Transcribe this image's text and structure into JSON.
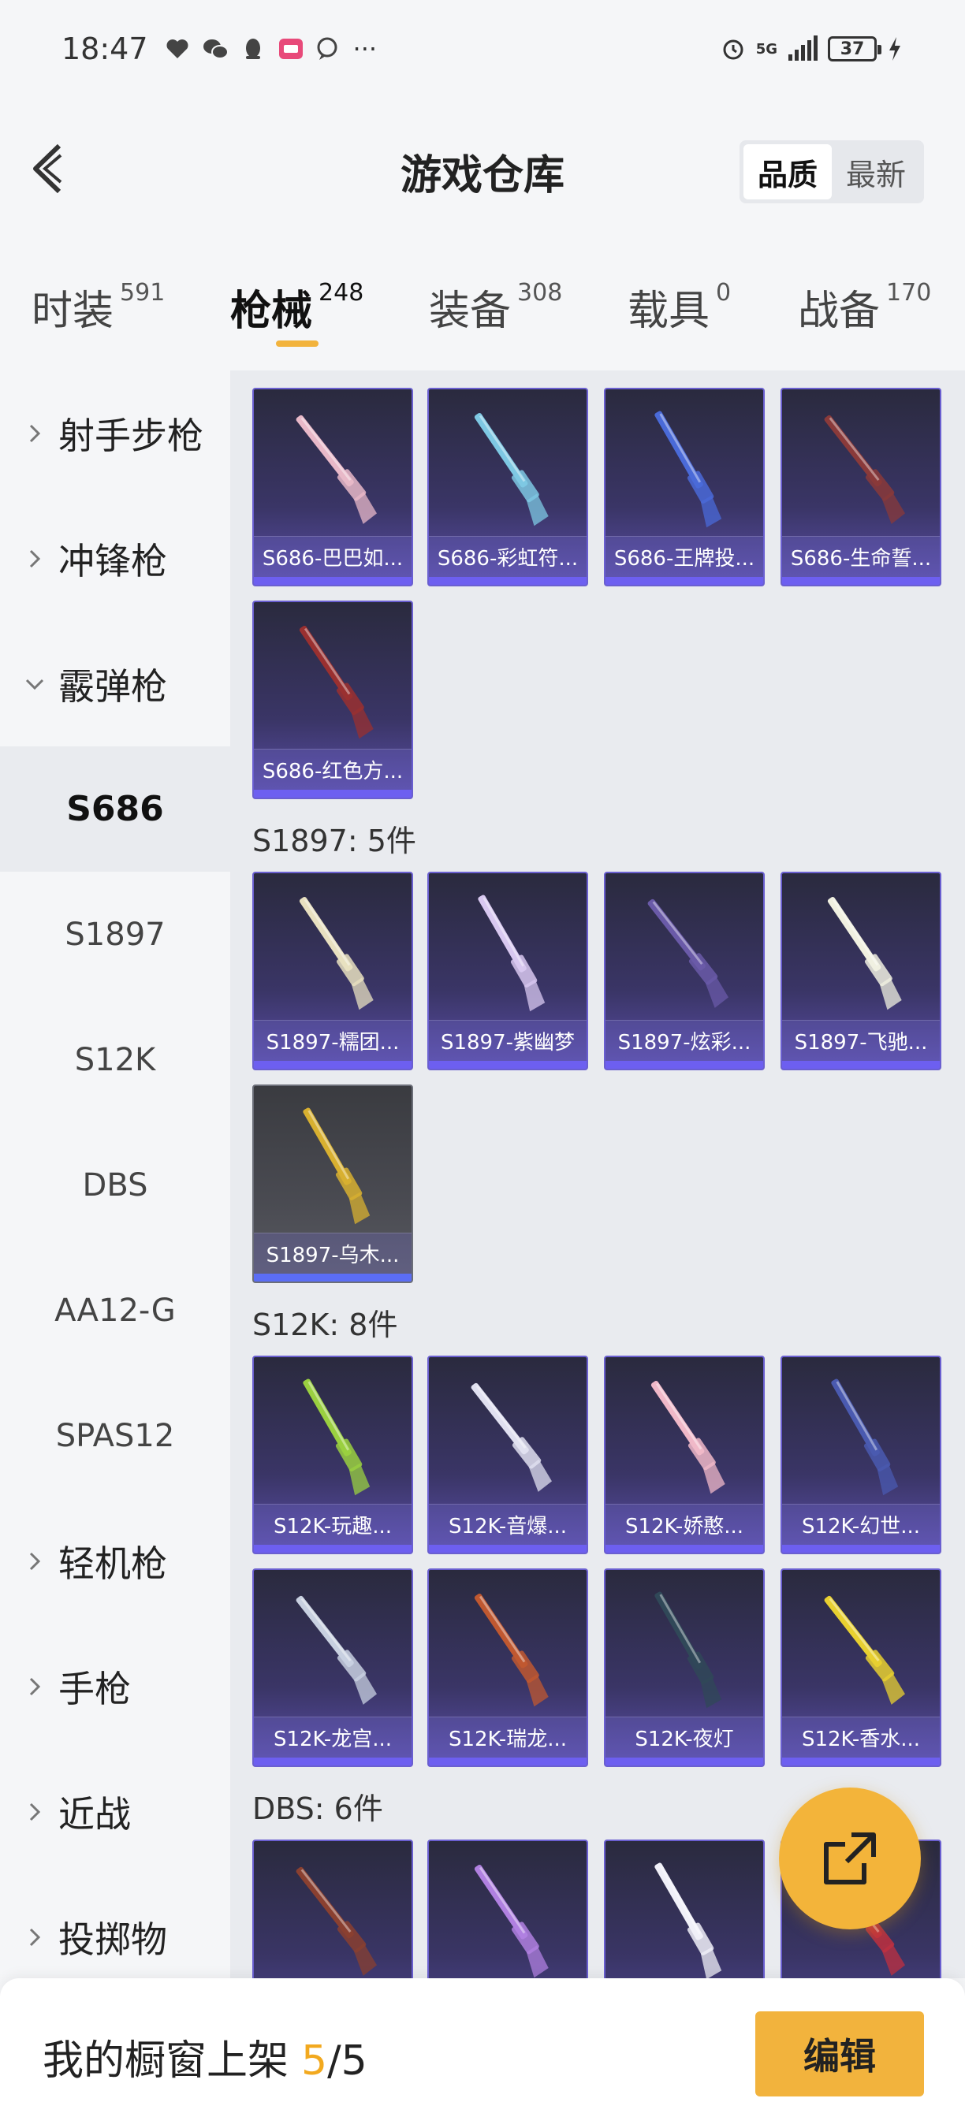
{
  "status_bar": {
    "time": "18:47",
    "network": "5G",
    "battery": "37"
  },
  "header": {
    "title": "游戏仓库",
    "sort_options": [
      "品质",
      "最新"
    ],
    "sort_active": "品质"
  },
  "tabs": [
    {
      "label": "时装",
      "count": "591"
    },
    {
      "label": "枪械",
      "count": "248",
      "active": true
    },
    {
      "label": "装备",
      "count": "308"
    },
    {
      "label": "载具",
      "count": "0"
    },
    {
      "label": "战备",
      "count": "170"
    }
  ],
  "sidebar": {
    "items": [
      {
        "label": "射手步枪",
        "type": "group",
        "expanded": false
      },
      {
        "label": "冲锋枪",
        "type": "group",
        "expanded": false
      },
      {
        "label": "霰弹枪",
        "type": "group",
        "expanded": true
      },
      {
        "label": "S686",
        "type": "sub",
        "selected": true
      },
      {
        "label": "S1897",
        "type": "sub"
      },
      {
        "label": "S12K",
        "type": "sub"
      },
      {
        "label": "DBS",
        "type": "sub"
      },
      {
        "label": "AA12-G",
        "type": "sub"
      },
      {
        "label": "SPAS12",
        "type": "sub"
      },
      {
        "label": "轻机枪",
        "type": "group",
        "expanded": false
      },
      {
        "label": "手枪",
        "type": "group",
        "expanded": false
      },
      {
        "label": "近战",
        "type": "group",
        "expanded": false
      },
      {
        "label": "投掷物",
        "type": "group",
        "expanded": false
      }
    ]
  },
  "sections": [
    {
      "label": "",
      "items": [
        {
          "name": "S686-巴巴如...",
          "color": "#e8b8c8"
        },
        {
          "name": "S686-彩虹符...",
          "color": "#7ec8e3"
        },
        {
          "name": "S686-王牌投...",
          "color": "#4a6ad8"
        },
        {
          "name": "S686-生命誓...",
          "color": "#8a3a3a"
        },
        {
          "name": "S686-红色方...",
          "color": "#9a3030"
        }
      ]
    },
    {
      "label": "S1897: 5件",
      "items": [
        {
          "name": "S1897-糯团...",
          "color": "#e8e0c0"
        },
        {
          "name": "S1897-紫幽梦",
          "color": "#d8c8f0"
        },
        {
          "name": "S1897-炫彩...",
          "color": "#6a5aa8"
        },
        {
          "name": "S1897-飞驰...",
          "color": "#f0f0e0"
        },
        {
          "name": "S1897-乌木...",
          "color": "#d8b030",
          "gray": true
        }
      ]
    },
    {
      "label": "S12K: 8件",
      "items": [
        {
          "name": "S12K-玩趣...",
          "color": "#9ad040"
        },
        {
          "name": "S12K-音爆...",
          "color": "#e0e0f0"
        },
        {
          "name": "S12K-娇憨...",
          "color": "#f0b8c8"
        },
        {
          "name": "S12K-幻世...",
          "color": "#4a5ab0"
        },
        {
          "name": "S12K-龙宫...",
          "color": "#c8d0e0"
        },
        {
          "name": "S12K-瑞龙...",
          "color": "#c05830"
        },
        {
          "name": "S12K-夜灯",
          "color": "#304858"
        },
        {
          "name": "S12K-香水...",
          "color": "#e8d030"
        }
      ]
    },
    {
      "label": "DBS: 6件",
      "items": [
        {
          "name": "",
          "color": "#8a4030"
        },
        {
          "name": "",
          "color": "#b080e0"
        },
        {
          "name": "",
          "color": "#f0f0f8"
        },
        {
          "name": "",
          "color": "#c03040"
        }
      ]
    }
  ],
  "bottom": {
    "shelf_label": "我的橱窗上架",
    "shelf_current": "5",
    "shelf_total": "/5",
    "edit_label": "编辑"
  }
}
